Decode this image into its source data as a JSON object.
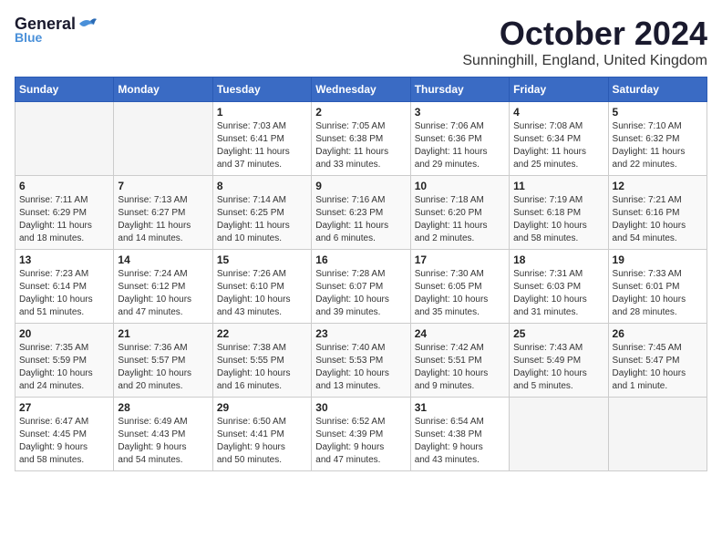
{
  "header": {
    "logo_general": "General",
    "logo_blue": "Blue",
    "title": "October 2024",
    "location": "Sunninghill, England, United Kingdom"
  },
  "days_of_week": [
    "Sunday",
    "Monday",
    "Tuesday",
    "Wednesday",
    "Thursday",
    "Friday",
    "Saturday"
  ],
  "weeks": [
    [
      {
        "day": "",
        "info": ""
      },
      {
        "day": "",
        "info": ""
      },
      {
        "day": "1",
        "info": "Sunrise: 7:03 AM\nSunset: 6:41 PM\nDaylight: 11 hours\nand 37 minutes."
      },
      {
        "day": "2",
        "info": "Sunrise: 7:05 AM\nSunset: 6:38 PM\nDaylight: 11 hours\nand 33 minutes."
      },
      {
        "day": "3",
        "info": "Sunrise: 7:06 AM\nSunset: 6:36 PM\nDaylight: 11 hours\nand 29 minutes."
      },
      {
        "day": "4",
        "info": "Sunrise: 7:08 AM\nSunset: 6:34 PM\nDaylight: 11 hours\nand 25 minutes."
      },
      {
        "day": "5",
        "info": "Sunrise: 7:10 AM\nSunset: 6:32 PM\nDaylight: 11 hours\nand 22 minutes."
      }
    ],
    [
      {
        "day": "6",
        "info": "Sunrise: 7:11 AM\nSunset: 6:29 PM\nDaylight: 11 hours\nand 18 minutes."
      },
      {
        "day": "7",
        "info": "Sunrise: 7:13 AM\nSunset: 6:27 PM\nDaylight: 11 hours\nand 14 minutes."
      },
      {
        "day": "8",
        "info": "Sunrise: 7:14 AM\nSunset: 6:25 PM\nDaylight: 11 hours\nand 10 minutes."
      },
      {
        "day": "9",
        "info": "Sunrise: 7:16 AM\nSunset: 6:23 PM\nDaylight: 11 hours\nand 6 minutes."
      },
      {
        "day": "10",
        "info": "Sunrise: 7:18 AM\nSunset: 6:20 PM\nDaylight: 11 hours\nand 2 minutes."
      },
      {
        "day": "11",
        "info": "Sunrise: 7:19 AM\nSunset: 6:18 PM\nDaylight: 10 hours\nand 58 minutes."
      },
      {
        "day": "12",
        "info": "Sunrise: 7:21 AM\nSunset: 6:16 PM\nDaylight: 10 hours\nand 54 minutes."
      }
    ],
    [
      {
        "day": "13",
        "info": "Sunrise: 7:23 AM\nSunset: 6:14 PM\nDaylight: 10 hours\nand 51 minutes."
      },
      {
        "day": "14",
        "info": "Sunrise: 7:24 AM\nSunset: 6:12 PM\nDaylight: 10 hours\nand 47 minutes."
      },
      {
        "day": "15",
        "info": "Sunrise: 7:26 AM\nSunset: 6:10 PM\nDaylight: 10 hours\nand 43 minutes."
      },
      {
        "day": "16",
        "info": "Sunrise: 7:28 AM\nSunset: 6:07 PM\nDaylight: 10 hours\nand 39 minutes."
      },
      {
        "day": "17",
        "info": "Sunrise: 7:30 AM\nSunset: 6:05 PM\nDaylight: 10 hours\nand 35 minutes."
      },
      {
        "day": "18",
        "info": "Sunrise: 7:31 AM\nSunset: 6:03 PM\nDaylight: 10 hours\nand 31 minutes."
      },
      {
        "day": "19",
        "info": "Sunrise: 7:33 AM\nSunset: 6:01 PM\nDaylight: 10 hours\nand 28 minutes."
      }
    ],
    [
      {
        "day": "20",
        "info": "Sunrise: 7:35 AM\nSunset: 5:59 PM\nDaylight: 10 hours\nand 24 minutes."
      },
      {
        "day": "21",
        "info": "Sunrise: 7:36 AM\nSunset: 5:57 PM\nDaylight: 10 hours\nand 20 minutes."
      },
      {
        "day": "22",
        "info": "Sunrise: 7:38 AM\nSunset: 5:55 PM\nDaylight: 10 hours\nand 16 minutes."
      },
      {
        "day": "23",
        "info": "Sunrise: 7:40 AM\nSunset: 5:53 PM\nDaylight: 10 hours\nand 13 minutes."
      },
      {
        "day": "24",
        "info": "Sunrise: 7:42 AM\nSunset: 5:51 PM\nDaylight: 10 hours\nand 9 minutes."
      },
      {
        "day": "25",
        "info": "Sunrise: 7:43 AM\nSunset: 5:49 PM\nDaylight: 10 hours\nand 5 minutes."
      },
      {
        "day": "26",
        "info": "Sunrise: 7:45 AM\nSunset: 5:47 PM\nDaylight: 10 hours\nand 1 minute."
      }
    ],
    [
      {
        "day": "27",
        "info": "Sunrise: 6:47 AM\nSunset: 4:45 PM\nDaylight: 9 hours\nand 58 minutes."
      },
      {
        "day": "28",
        "info": "Sunrise: 6:49 AM\nSunset: 4:43 PM\nDaylight: 9 hours\nand 54 minutes."
      },
      {
        "day": "29",
        "info": "Sunrise: 6:50 AM\nSunset: 4:41 PM\nDaylight: 9 hours\nand 50 minutes."
      },
      {
        "day": "30",
        "info": "Sunrise: 6:52 AM\nSunset: 4:39 PM\nDaylight: 9 hours\nand 47 minutes."
      },
      {
        "day": "31",
        "info": "Sunrise: 6:54 AM\nSunset: 4:38 PM\nDaylight: 9 hours\nand 43 minutes."
      },
      {
        "day": "",
        "info": ""
      },
      {
        "day": "",
        "info": ""
      }
    ]
  ]
}
